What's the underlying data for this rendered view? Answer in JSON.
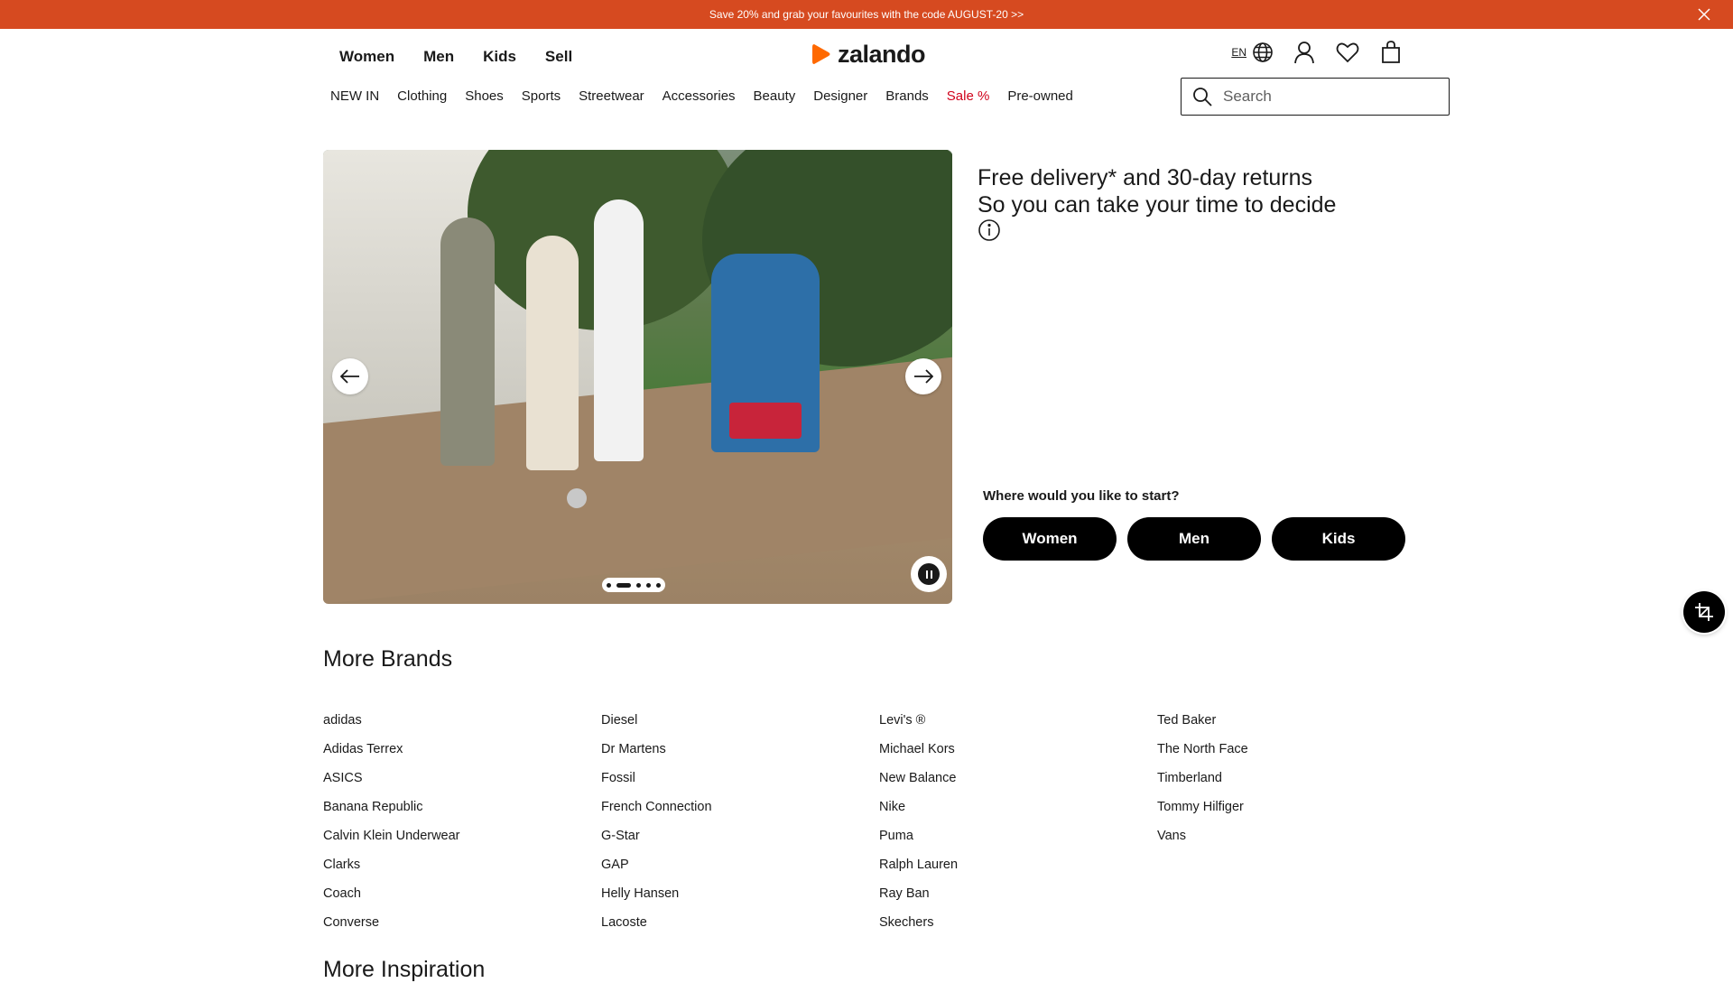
{
  "promo": {
    "text": "Save 20% and grab your favourites with the code AUGUST-20 >>",
    "close_icon": "close-icon"
  },
  "header": {
    "gender_nav": [
      "Women",
      "Men",
      "Kids",
      "Sell"
    ],
    "logo_text": "zalando",
    "language": "EN",
    "icons": [
      "globe-icon",
      "user-icon",
      "heart-icon",
      "bag-icon"
    ]
  },
  "category_nav": [
    "NEW IN",
    "Clothing",
    "Shoes",
    "Sports",
    "Streetwear",
    "Accessories",
    "Beauty",
    "Designer",
    "Brands",
    "Sale %",
    "Pre-owned"
  ],
  "search": {
    "placeholder": "Search",
    "value": ""
  },
  "hero": {
    "slide_count": 5,
    "active_slide": 2,
    "prev_icon": "arrow-left-icon",
    "next_icon": "arrow-right-icon",
    "pause_icon": "pause-icon"
  },
  "delivery": {
    "line1": "Free delivery* and 30-day returns",
    "line2": "So you can take your time to decide"
  },
  "start": {
    "label": "Where would you like to start?",
    "buttons": [
      "Women",
      "Men",
      "Kids"
    ]
  },
  "more_brands": {
    "title": "More Brands",
    "columns": [
      [
        "adidas",
        "Adidas Terrex",
        "ASICS",
        "Banana Republic",
        "Calvin Klein Underwear",
        "Clarks",
        "Coach",
        "Converse"
      ],
      [
        "Diesel",
        "Dr Martens",
        "Fossil",
        "French Connection",
        "G-Star",
        "GAP",
        "Helly Hansen",
        "Lacoste"
      ],
      [
        "Levi's ®",
        "Michael Kors",
        "New Balance",
        "Nike",
        "Puma",
        "Ralph Lauren",
        "Ray Ban",
        "Skechers"
      ],
      [
        "Ted Baker",
        "The North Face",
        "Timberland",
        "Tommy Hilfiger",
        "Vans"
      ]
    ]
  },
  "more_inspiration": {
    "title": "More Inspiration"
  },
  "colors": {
    "promo_bg": "#d64a20",
    "brand_orange": "#ff6900",
    "sale_red": "#d0021b",
    "button_black": "#000000"
  }
}
